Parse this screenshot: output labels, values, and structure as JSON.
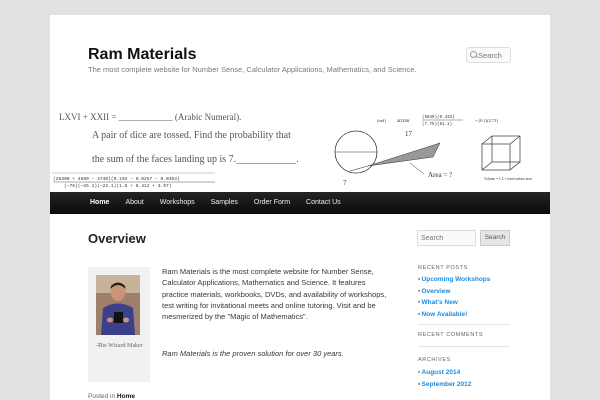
{
  "site": {
    "title": "Ram Materials",
    "description": "The most complete website for Number Sense, Calculator Applications, Mathematics, and Science.",
    "search_placeholder": "Search"
  },
  "banner": {
    "roman_problem": "LXVI + XXII = ____________ (Arabic Numeral).",
    "dice_line1": "A pair of dice are tossed.   Find the probability that",
    "dice_line2": "the sum of the faces landing up is  7.____________.",
    "calc_line1": "(26300 + 4680 − 4740)(0.102 − 0.0257 − 0.0353)",
    "calc_line2": "(−76)(−25.1)(−22.1)(1.8 + 0.412 + 3.97)",
    "rad_label": "(rad)",
    "arctan_label": "arctan",
    "arctan_num": "(9830)(0.333)",
    "arctan_den": "(7.75)(61.1)",
    "arctan_tail": "+ (0.1)(2.71)",
    "circle_label_17": "17",
    "circle_label_7": "7",
    "area_label": "Area = ?",
    "cube_label": "Volume = 1.2 × total surface area"
  },
  "nav": {
    "items": [
      "Home",
      "About",
      "Workshops",
      "Samples",
      "Order Form",
      "Contact Us"
    ]
  },
  "content": {
    "title": "Overview",
    "caption_dash": "—",
    "caption": "The Wizard Maker",
    "paragraph1": "Ram Materials is the most complete website for Number Sense, Calculator Applications, Mathematics and Science. It features practice materials, workbooks, DVDs, and availability of workshops, test writing for invitational meets and online tutoring. Visit and be mesmerized by the \"Magic of Mathematics\".",
    "paragraph2": "Ram Materials is the proven solution for over 30 years.",
    "posted_in_label": "Posted in",
    "posted_in_value": "Home"
  },
  "sidebar": {
    "search_placeholder": "Search",
    "search_button": "Search",
    "recent_posts_title": "RECENT POSTS",
    "recent_posts": [
      "Upcoming Workshops",
      "Overview",
      "What's New",
      "Now Available!"
    ],
    "recent_comments_title": "RECENT COMMENTS",
    "archives_title": "ARCHIVES",
    "archives": [
      "August 2014",
      "September 2012"
    ]
  },
  "colors": {
    "link": "#1b8be0",
    "nav_bg": "#1a1a1a",
    "page_bg": "#e2e2e2"
  }
}
